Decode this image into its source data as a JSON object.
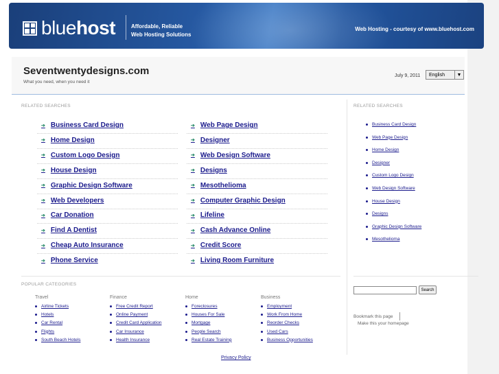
{
  "header": {
    "logo_light": "blue",
    "logo_bold": "host",
    "tagline_1": "Affordable, Reliable",
    "tagline_2": "Web Hosting Solutions",
    "courtesy": "Web Hosting - courtesy of www.bluehost.com"
  },
  "site": {
    "title": "Seventwentydesigns.com",
    "subtitle": "What you need, when you need it",
    "date": "July 9, 2011",
    "language": "English"
  },
  "related_label": "RELATED SEARCHES",
  "main_links_left": [
    "Business Card Design",
    "Home Design",
    "Custom Logo Design",
    "House Design",
    "Graphic Design Software",
    "Web Developers",
    "Car Donation",
    "Find A Dentist",
    "Cheap Auto Insurance",
    "Phone Service"
  ],
  "main_links_right": [
    "Web Page Design",
    "Designer",
    "Web Design Software",
    "Designs",
    "Mesothelioma",
    "Computer Graphic Design",
    "Lifeline",
    "Cash Advance Online",
    "Credit Score",
    "Living Room Furniture"
  ],
  "side_label": "RELATED SEARCHES",
  "side_links": [
    "Business Card Design",
    "Web Page Design",
    "Home Design",
    "Designer",
    "Custom Logo Design",
    "Web Design Software",
    "House Design",
    "Designs",
    "Graphic Design Software",
    "Mesothelioma"
  ],
  "popular_label": "POPULAR CATEGORIES",
  "categories": [
    {
      "title": "Travel",
      "links": [
        "Airline Tickets",
        "Hotels",
        "Car Rental",
        "Flights",
        "South Beach Hotels"
      ]
    },
    {
      "title": "Finance",
      "links": [
        "Free Credit Report",
        "Online Payment",
        "Credit Card Application",
        "Car Insurance",
        "Health Insurance"
      ]
    },
    {
      "title": "Home",
      "links": [
        "Foreclosures",
        "Houses For Sale",
        "Mortgage",
        "People Search",
        "Real Estate Training"
      ]
    },
    {
      "title": "Business",
      "links": [
        "Employment",
        "Work From Home",
        "Reorder Checks",
        "Used Cars",
        "Business Opportunities"
      ]
    }
  ],
  "search_button": "Search",
  "bookmark": "Bookmark this page",
  "homepage": "Make this your homepage",
  "privacy": "Privacy Policy"
}
